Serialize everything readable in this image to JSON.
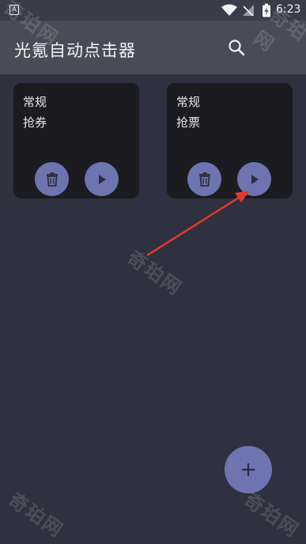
{
  "status_bar": {
    "notification_icon": "text-a-icon",
    "notification_glyph": "A",
    "time": "6:23",
    "icons": [
      "wifi-icon",
      "no-signal-icon",
      "battery-charging-icon"
    ]
  },
  "app_bar": {
    "title": "光氪自动点击器",
    "search_icon": "search-icon"
  },
  "cards": [
    {
      "line1": "常规",
      "line2": "抢券"
    },
    {
      "line1": "常规",
      "line2": "抢票"
    }
  ],
  "fab": {
    "icon": "plus-icon"
  },
  "watermarks": [
    "奇珀网",
    "奇珀网",
    "奇珀网",
    "奇珀网",
    "奇珀网"
  ],
  "colors": {
    "background": "#2f3040",
    "app_bar": "#4a4b58",
    "card": "#1b1b20",
    "button": "#6e74b0",
    "annotation_arrow": "#e03a2f"
  }
}
